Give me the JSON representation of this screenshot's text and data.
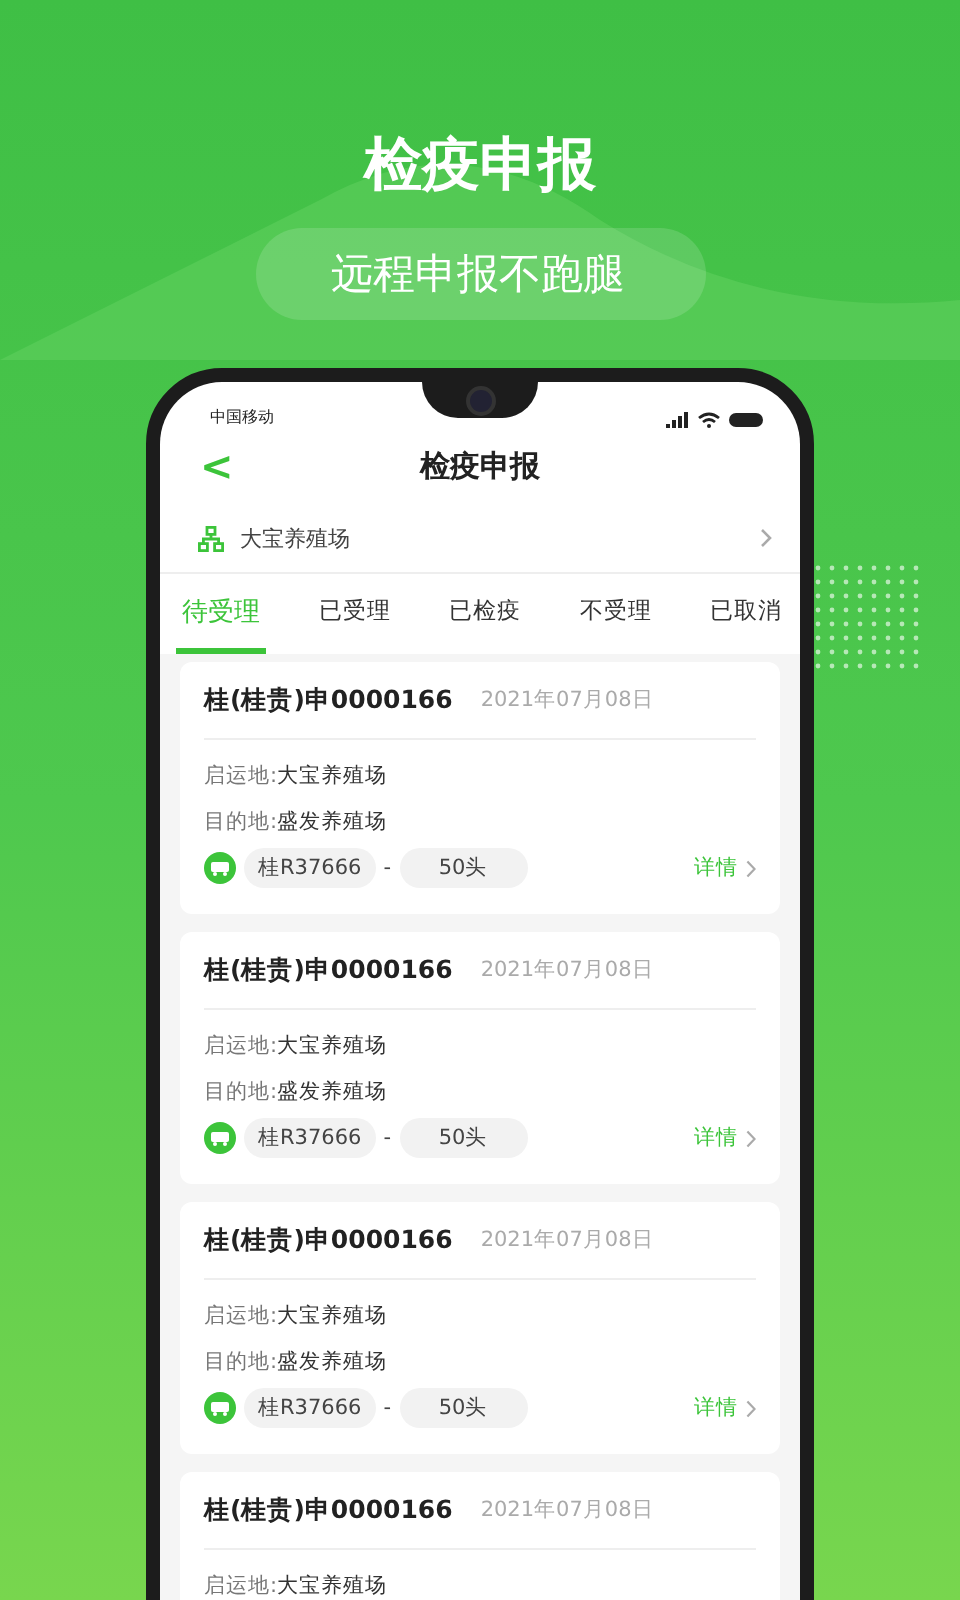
{
  "headline": "检疫申报",
  "slogan": "远程申报不跑腿",
  "status_bar": {
    "carrier": "中国移动"
  },
  "nav": {
    "back": "<",
    "title": "检疫申报"
  },
  "farm": {
    "name": "大宝养殖场"
  },
  "tabs": [
    {
      "label": "待受理",
      "selected": true
    },
    {
      "label": "已受理",
      "selected": false
    },
    {
      "label": "已检疫",
      "selected": false
    },
    {
      "label": "不受理",
      "selected": false
    },
    {
      "label": "已取消",
      "selected": false
    }
  ],
  "cards": [
    {
      "number": "桂(桂贵)申0000166",
      "date": "2021年07月08日",
      "origin_label": "启运地:",
      "origin": "大宝养殖场",
      "dest_label": "目的地:",
      "dest": "盛发养殖场",
      "plate": "桂R37666",
      "dash": "-",
      "count": "50头",
      "detail": "详情"
    },
    {
      "number": "桂(桂贵)申0000166",
      "date": "2021年07月08日",
      "origin_label": "启运地:",
      "origin": "大宝养殖场",
      "dest_label": "目的地:",
      "dest": "盛发养殖场",
      "plate": "桂R37666",
      "dash": "-",
      "count": "50头",
      "detail": "详情"
    },
    {
      "number": "桂(桂贵)申0000166",
      "date": "2021年07月08日",
      "origin_label": "启运地:",
      "origin": "大宝养殖场",
      "dest_label": "目的地:",
      "dest": "盛发养殖场",
      "plate": "桂R37666",
      "dash": "-",
      "count": "50头",
      "detail": "详情"
    },
    {
      "number": "桂(桂贵)申0000166",
      "date": "2021年07月08日",
      "origin_label": "启运地:",
      "origin": "大宝养殖场"
    }
  ]
}
